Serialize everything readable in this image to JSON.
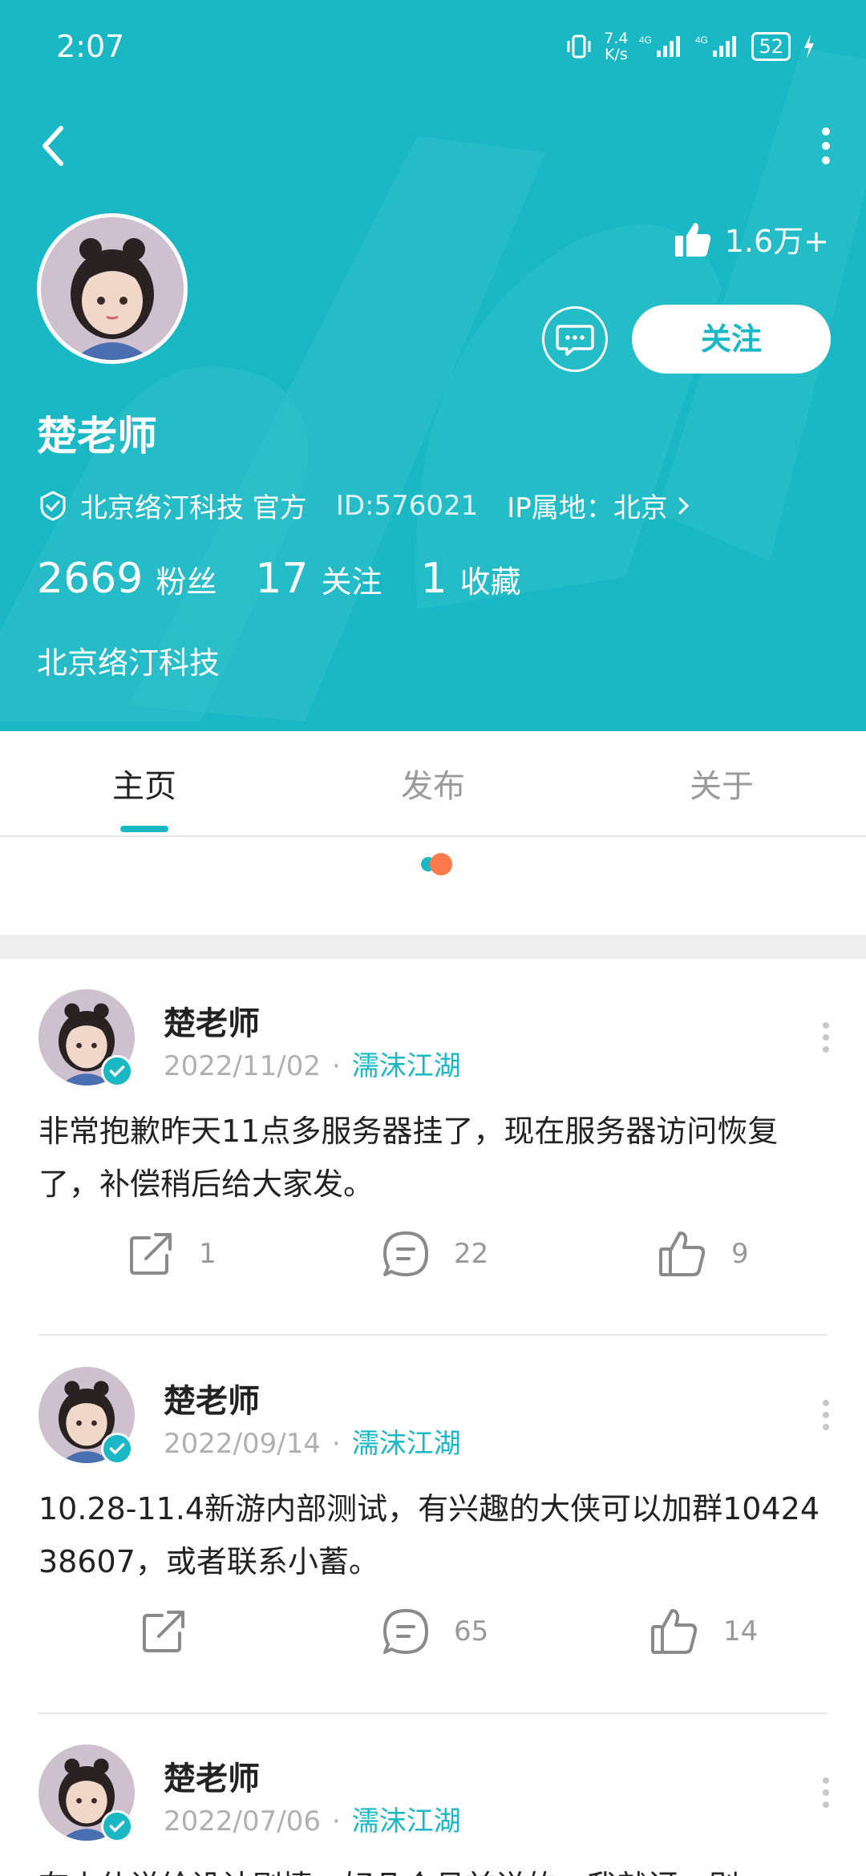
{
  "status_bar": {
    "time": "2:07",
    "net_speed_value": "7.4",
    "net_speed_unit": "K/s",
    "signal1": "4G",
    "signal2": "4G",
    "battery": "52"
  },
  "header": {
    "likes": "1.6万+",
    "follow_label": "关注",
    "name": "楚老师",
    "org": "北京络汀科技 官方",
    "id_text": "ID:576021",
    "ip_text": "IP属地：北京",
    "stats": {
      "fans_num": "2669",
      "fans_label": "粉丝",
      "follow_num": "17",
      "follow_label": "关注",
      "fav_num": "1",
      "fav_label": "收藏"
    },
    "company": "北京络汀科技",
    "colors": {
      "header_bg": "#1ab8c4",
      "accent": "#1ab8c4"
    }
  },
  "tabs": [
    {
      "label": "主页",
      "active": true
    },
    {
      "label": "发布",
      "active": false
    },
    {
      "label": "关于",
      "active": false
    }
  ],
  "posts": [
    {
      "author": "楚老师",
      "date": "2022/11/02",
      "circle": "濡沫江湖",
      "text": "非常抱歉昨天11点多服务器挂了，现在服务器访问恢复了，补偿稍后给大家发。",
      "share_count": "1",
      "comment_count": "22",
      "like_count": "9"
    },
    {
      "author": "楚老师",
      "date": "2022/09/14",
      "circle": "濡沫江湖",
      "text": "10.28-11.4新游内部测试，有兴趣的大侠可以加群1042438607，或者联系小蓄。",
      "share_count": "",
      "comment_count": "65",
      "like_count": "14"
    },
    {
      "author": "楚老师",
      "date": "2022/07/06",
      "circle": "濡沫江湖",
      "text": "有小伙说给设计剧情，好几个月前说的，我就讶，别"
    }
  ]
}
